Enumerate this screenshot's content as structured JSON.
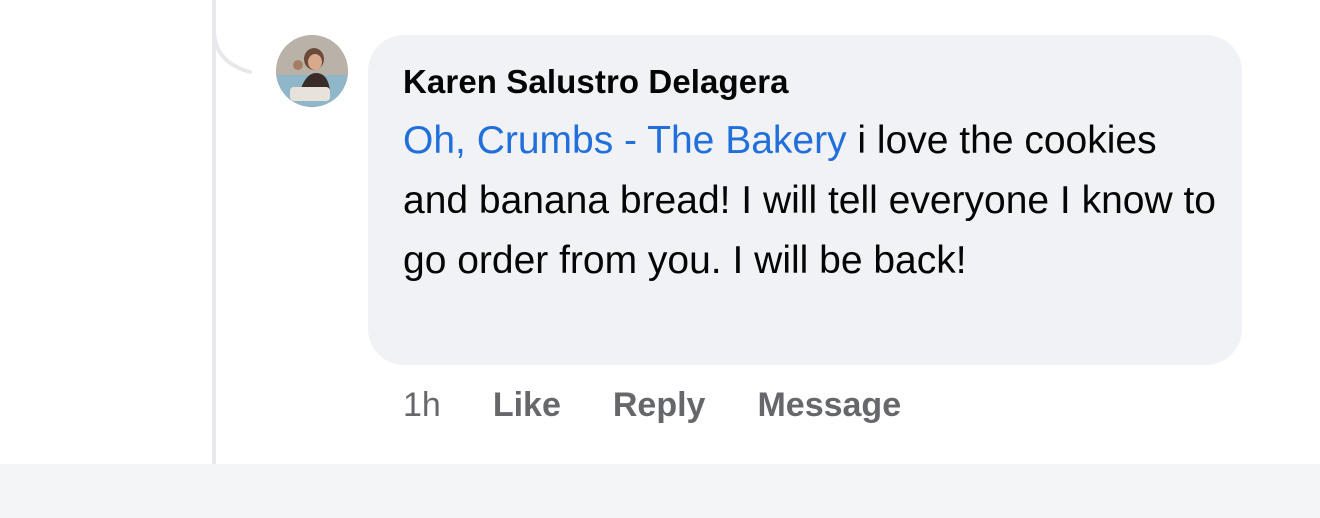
{
  "comment": {
    "author": "Karen Salustro Delagera",
    "mention": "Oh, Crumbs - The Bakery",
    "text": " i love the cookies  and banana bread! I will tell everyone I know to go order from you. I will be back!",
    "time": "1h",
    "actions": {
      "like": "Like",
      "reply": "Reply",
      "message": "Message"
    },
    "avatar_icon": "profile-photo"
  },
  "colors": {
    "bubble_bg": "#f0f2f5",
    "mention": "#216fdb",
    "action_text": "#65676b",
    "thread_line": "#e6e8ec"
  }
}
